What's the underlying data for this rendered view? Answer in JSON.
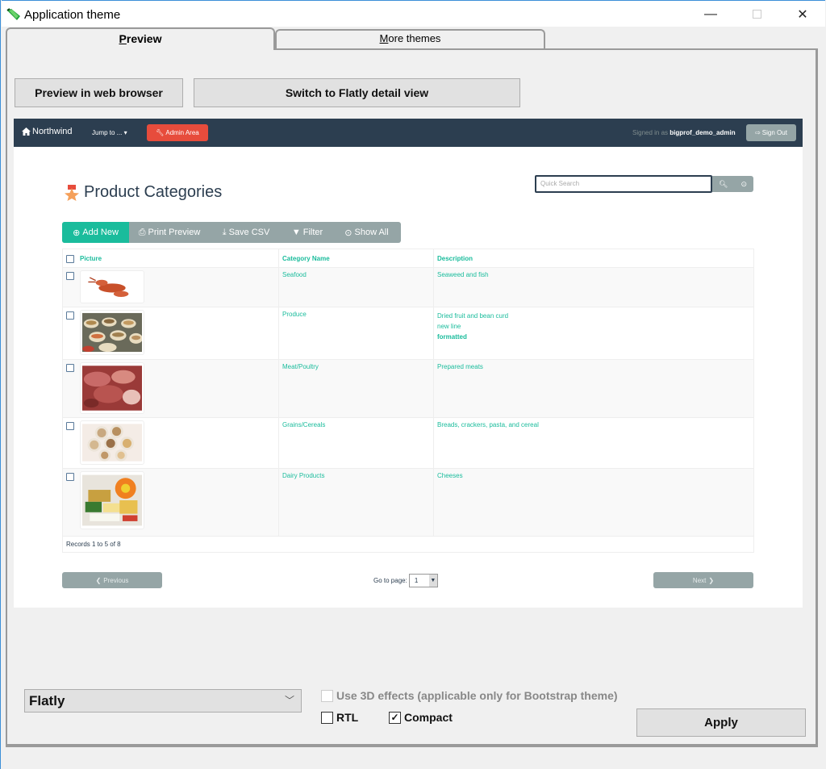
{
  "window": {
    "title": "Application theme",
    "controls": {
      "minimize": "—",
      "close": "✕"
    }
  },
  "tabs": [
    {
      "label_prefix": "",
      "label_underline": "P",
      "label_rest": "review",
      "active": true
    },
    {
      "label_prefix": "",
      "label_underline": "M",
      "label_rest": "ore themes",
      "active": false
    }
  ],
  "actions": {
    "preview_browser": "Preview in web browser",
    "switch_detail": "Switch to Flatly detail view"
  },
  "preview": {
    "navbar": {
      "brand": "Northwind",
      "jump_to": "Jump to ... ▾",
      "admin_area": "Admin Area",
      "signed_in_prefix": "Signed in as",
      "username": "bigprof_demo_admin",
      "sign_out": "Sign Out"
    },
    "search": {
      "placeholder": "Quick Search"
    },
    "page_title": "Product Categories",
    "toolbar": {
      "add_new": "Add New",
      "print_preview": "Print Preview",
      "save_csv": "Save CSV",
      "filter": "Filter",
      "show_all": "Show All"
    },
    "table": {
      "headers": [
        "Picture",
        "Category Name",
        "Description"
      ],
      "rows": [
        {
          "picture": "lobster",
          "category": "Seafood",
          "description": [
            "Seaweed and fish"
          ]
        },
        {
          "picture": "produce-sacks",
          "category": "Produce",
          "description": [
            "Dried fruit and bean curd",
            "new line",
            "formatted"
          ]
        },
        {
          "picture": "meats",
          "category": "Meat/Poultry",
          "description": [
            "Prepared meats"
          ]
        },
        {
          "picture": "grain-sacks",
          "category": "Grains/Cereals",
          "description": [
            "Breads, crackers, pasta, and cereal"
          ]
        },
        {
          "picture": "dairy-products",
          "category": "Dairy Products",
          "description": [
            "Cheeses"
          ]
        }
      ],
      "footer": "Records 1 to 5 of 8"
    },
    "pager": {
      "previous": "Previous",
      "next": "Next",
      "goto_label": "Go to page:",
      "goto_value": "1"
    },
    "colors": {
      "navbar": "#2c3e50",
      "primary": "#1abc9c",
      "danger": "#e74c3c",
      "muted": "#95a5a6"
    }
  },
  "settings": {
    "theme_selected": "Flatly",
    "use_3d_label": "Use 3D effects (applicable only for Bootstrap theme)",
    "use_3d_checked": false,
    "use_3d_enabled": false,
    "rtl_label": "RTL",
    "rtl_checked": false,
    "compact_label": "Compact",
    "compact_checked": true,
    "apply": "Apply"
  }
}
